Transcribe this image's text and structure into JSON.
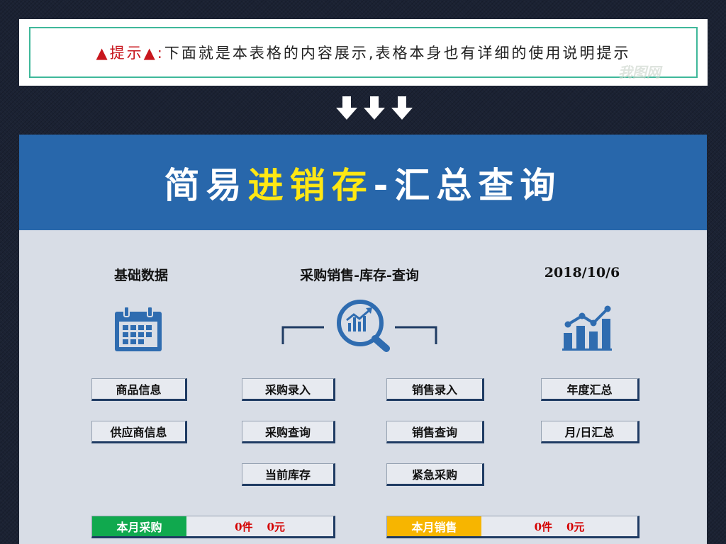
{
  "notice": {
    "prefix": "▲提示▲:",
    "text": "下面就是本表格的内容展示,表格本身也有详细的使用说明提示"
  },
  "watermark": "我图网",
  "title": {
    "part1": "简易",
    "part2": "进销存",
    "part3": "-汇总查询"
  },
  "sections": {
    "basic": "基础数据",
    "center": "采购销售-库存-查询",
    "date": "2018/10/6"
  },
  "buttons": {
    "product_info": "商品信息",
    "supplier_info": "供应商信息",
    "purchase_entry": "采购录入",
    "purchase_query": "采购查询",
    "current_stock": "当前库存",
    "sales_entry": "销售录入",
    "sales_query": "销售查询",
    "urgent_purchase": "紧急采购",
    "yearly_summary": "年度汇总",
    "monthly_daily_summary": "月/日汇总"
  },
  "summary": {
    "purchase_label": "本月采购",
    "purchase_count": "0件",
    "purchase_amount": "0元",
    "sales_label": "本月销售",
    "sales_count": "0件",
    "sales_amount": "0元"
  },
  "colors": {
    "banner": "#2867ab",
    "accent_yellow": "#ffe713",
    "purchase_green": "#10a94e",
    "sales_orange": "#f7b500",
    "icon_blue": "#2f6cb0"
  },
  "icons": [
    "calendar-icon",
    "magnifier-chart-icon",
    "bar-chart-trend-icon",
    "down-arrow-icon"
  ]
}
